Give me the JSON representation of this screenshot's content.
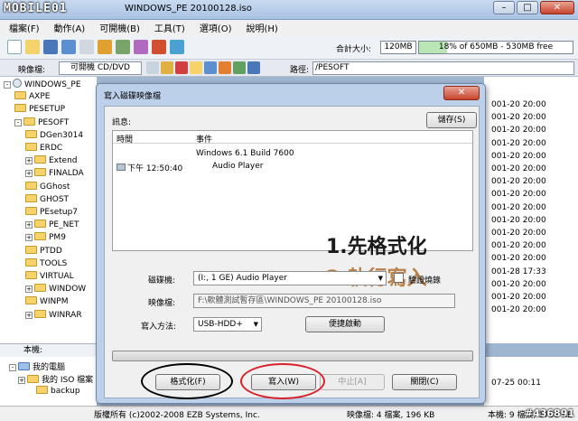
{
  "app": {
    "watermark": "MOBILE01",
    "title": "UltraISO - [WINDOWS_PE 20100128.iso]",
    "title_visible": "WINDOWS_PE 20100128.iso"
  },
  "menu": [
    "檔案(F)",
    "動作(A)",
    "可開機(B)",
    "工具(T)",
    "選項(O)",
    "說明(H)"
  ],
  "toolbar": {
    "total_label": "合計大小:",
    "total_value": "120MB",
    "capacity_text": "18% of 650MB - 530MB free",
    "capacity_fraction": 0.18
  },
  "image_bar": {
    "label": "映像檔:",
    "type": "可開機 CD/DVD",
    "path_label": "路徑:",
    "path_value": "/PESOFT"
  },
  "tree": [
    {
      "label": "WINDOWS_PE",
      "indent": 0,
      "expander": "-"
    },
    {
      "label": "AXPE",
      "indent": 1,
      "expander": ""
    },
    {
      "label": "PESETUP",
      "indent": 1,
      "expander": ""
    },
    {
      "label": "PESOFT",
      "indent": 1,
      "expander": "-"
    },
    {
      "label": "DGen3014",
      "indent": 2,
      "expander": ""
    },
    {
      "label": "ERDC",
      "indent": 2,
      "expander": ""
    },
    {
      "label": "Extend",
      "indent": 2,
      "expander": "+"
    },
    {
      "label": "FINALDA",
      "indent": 2,
      "expander": "+"
    },
    {
      "label": "GGhost",
      "indent": 2,
      "expander": ""
    },
    {
      "label": "GHOST",
      "indent": 2,
      "expander": ""
    },
    {
      "label": "PEsetup7",
      "indent": 2,
      "expander": ""
    },
    {
      "label": "PE_NET",
      "indent": 2,
      "expander": "+"
    },
    {
      "label": "PM9",
      "indent": 2,
      "expander": "+"
    },
    {
      "label": "PTDD",
      "indent": 2,
      "expander": ""
    },
    {
      "label": "TOOLS",
      "indent": 2,
      "expander": ""
    },
    {
      "label": "VIRTUAL",
      "indent": 2,
      "expander": ""
    },
    {
      "label": "WINDOW",
      "indent": 2,
      "expander": "+"
    },
    {
      "label": "WINPM",
      "indent": 2,
      "expander": ""
    },
    {
      "label": "WINRAR",
      "indent": 2,
      "expander": "+"
    }
  ],
  "right_list": [
    "001-20 20:00",
    "001-20 20:00",
    "001-20 20:00",
    "001-20 20:00",
    "001-20 20:00",
    "001-20 20:00",
    "001-20 20:00",
    "001-20 20:00",
    "001-20 20:00",
    "001-20 20:00",
    "001-20 20:00",
    "001-20 20:00",
    "001-20 20:00",
    "001-28 17:33",
    "001-20 20:00",
    "001-20 20:00",
    "001-20 20:00"
  ],
  "bottom": {
    "label": "本機:",
    "tree": [
      "我的電腦",
      "我的 ISO 檔案",
      "backup"
    ],
    "right": "07-25 00:11"
  },
  "status": {
    "copyright": "版權所有 (c)2002-2008 EZB Systems, Inc.",
    "image": "映像檔: 4 檔案, 196 KB",
    "local": "本機: 9 檔案, 1738 KB",
    "watermark": "#436891"
  },
  "dialog": {
    "title": "寫入磁碟映像檔",
    "close": "✕",
    "info_label": "訊息:",
    "save_button": "儲存(S)",
    "log_columns": [
      "時間",
      "事件"
    ],
    "log_rows": [
      {
        "time": "",
        "event": "Windows 6.1 Build 7600"
      },
      {
        "time": "下午 12:50:40",
        "event": "Audio Player"
      }
    ],
    "drive_label": "磁碟機:",
    "drive_value": "(I:, 1 GE)     Audio Player",
    "verify_label": "驗證燒錄",
    "image_label": "映像檔:",
    "image_value": "F:\\軟體測試暫存區\\WINDOWS_PE 20100128.iso",
    "method_label": "寫入方法:",
    "method_value": "USB-HDD+",
    "convenient_button": "便捷啟動",
    "format_button": "格式化(F)",
    "write_button": "寫入(W)",
    "abort_button": "中止[A]",
    "close_button": "關閉(C)",
    "progress": 0,
    "annotation_1": "1.先格式化",
    "annotation_2": "2.執行寫入"
  }
}
